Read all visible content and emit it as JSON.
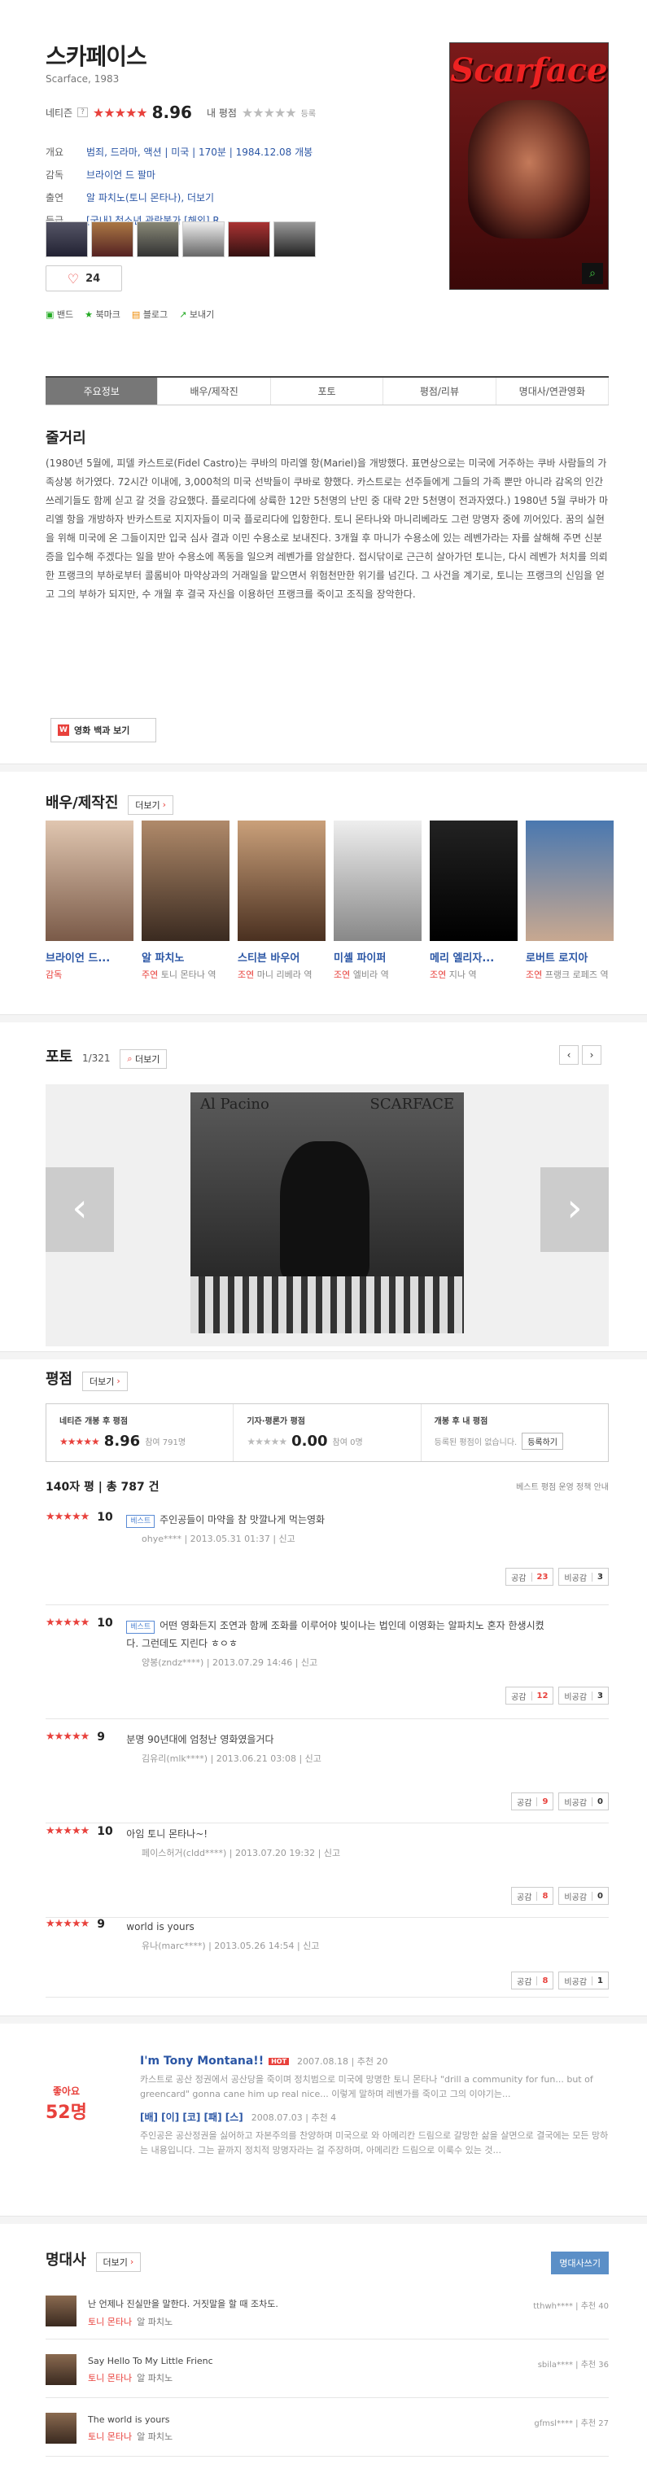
{
  "movie": {
    "title": "스카페이스",
    "subtitle": "Scarface, 1983",
    "netizen_label": "네티즌",
    "netizen_score": "8.96",
    "my_rating_label": "내 평점",
    "register_label": "등록",
    "info": [
      {
        "key": "개요",
        "value": "범죄, 드라마, 액션 | 미국 | 170분 | 1984.12.08 개봉"
      },
      {
        "key": "감독",
        "value": "브라이언 드 팔마"
      },
      {
        "key": "출연",
        "value": "알 파치노(토니 몬타나), 더보기"
      },
      {
        "key": "등급",
        "value": "[국내] 청소년 관람불가 [해외] R"
      }
    ],
    "like_count": "24",
    "share": [
      "밴드",
      "북마크",
      "블로그",
      "보내기"
    ],
    "poster_title": "Scarface"
  },
  "tabs": [
    "주요정보",
    "배우/제작진",
    "포토",
    "평점/리뷰",
    "명대사/연관영화"
  ],
  "synopsis": {
    "title": "줄거리",
    "text": "(1980년 5월에, 피델 카스트로(Fidel Castro)는 쿠바의 마리엘 항(Mariel)을 개방했다. 표면상으로는 미국에 거주하는 쿠바 사람들의 가족상봉 허가였다. 72시간 이내에, 3,000척의 미국 선박들이 쿠바로 향했다. 카스트로는 선주들에게 그들의 가족 뿐만 아니라 감옥의 인간 쓰레기들도 함께 싣고 갈 것을 강요했다. 플로리다에 상륙한 12만 5천명의 난민 중 대략 2만 5천명이 전과자였다.) 1980년 5월 쿠바가 마리엘 항을 개방하자 반카스트로 지지자들이 미국 플로리다에 입항한다. 토니 몬타나와 마니리베라도 그런 망명자 중에 끼어있다. 꿈의 실현을 위해 미국에 온 그들이지만 입국 심사 결과 이민 수용소로 보내진다. 3개월 후 마니가 수용소에 있는 레벤가라는 자를 살해해 주면 신분증을 입수해 주겠다는 일을 받아 수용소에 폭동을 일으켜 레벤가를 암살한다. 접시닦이로 근근히 살아가던 토니는, 다시 레벤가 처치를 의뢰한 프랭크의 부하로부터 콜롬비아 마약상과의 거래일을 맡으면서 위험천만한 위기를 넘긴다. 그 사건을 계기로, 토니는 프랭크의 신임을 얻고 그의 부하가 되지만, 수 개월 후 결국 자신을 이용하던 프랭크를 죽이고 조직을 장악한다.",
    "wiki_label": "영화 백과 보기"
  },
  "cast": {
    "title": "배우/제작진",
    "more": "더보기",
    "people": [
      {
        "name": "브라이언 드...",
        "role_type": "감독",
        "role": ""
      },
      {
        "name": "알 파치노",
        "role_type": "주연",
        "role": "토니 몬타나 역"
      },
      {
        "name": "스티븐 바우어",
        "role_type": "조연",
        "role": "마니 리베라 역"
      },
      {
        "name": "미셸 파이퍼",
        "role_type": "조연",
        "role": "엘비라 역"
      },
      {
        "name": "메리 엘리자...",
        "role_type": "조연",
        "role": "지나 역"
      },
      {
        "name": "로버트 로지아",
        "role_type": "조연",
        "role": "프랭크 로페즈 역"
      }
    ]
  },
  "photo": {
    "title": "포토",
    "counter": "1/321",
    "more": "더보기",
    "caption_left": "Al Pacino",
    "caption_right": "SCARFACE"
  },
  "rating": {
    "title": "평점",
    "more": "더보기",
    "netizen_label": "네티즌 개봉 후 평점",
    "netizen_score": "8.96",
    "netizen_count": "참여 791명",
    "critic_label": "기자·평론가 평점",
    "critic_score": "0.00",
    "critic_count": "참여 0명",
    "mine_label": "개봉 후 내 평점",
    "mine_text": "등록된 평점이 없습니다.",
    "mine_btn": "등록하기",
    "summary": "140자 평 | 총 787 건",
    "policy": "베스트 평점 운영 정책 안내"
  },
  "reviews": [
    {
      "score": "10",
      "best": "베스트",
      "text": "주인공들이 마약을 참 맛깔나게 먹는영화",
      "meta": "ohye**** | 2013.05.31 01:37 | 신고",
      "up": "23",
      "down": "3"
    },
    {
      "score": "10",
      "best": "베스트",
      "text": "어떤 영화든지 조연과 함께 조화를 이루어야 빛이나는 법인데 이영화는 알파치노 혼자 한생시켰다. 그런데도 지린다 ㅎㅇㅎ",
      "meta": "양봉(zndz****) | 2013.07.29 14:46 | 신고",
      "up": "12",
      "down": "3"
    },
    {
      "score": "9",
      "best": "",
      "text": "분명 90년대에 엄청난 영화였을거다",
      "meta": "김유리(mlk****) | 2013.06.21 03:08 | 신고",
      "up": "9",
      "down": "0"
    },
    {
      "score": "10",
      "best": "",
      "text": "아임 토니 몬타나~!",
      "meta": "페이스허거(cldd****) | 2013.07.20 19:32 | 신고",
      "up": "8",
      "down": "0"
    },
    {
      "score": "9",
      "best": "",
      "text": "world is yours",
      "meta": "유나(marc****) | 2013.05.26 14:54 | 신고",
      "up": "8",
      "down": "1"
    }
  ],
  "vote_up_label": "공감",
  "vote_down_label": "비공감",
  "news": {
    "likes_label": "좋아요",
    "likes_count": "52명",
    "headline": "I'm Tony Montana!!",
    "hot": "HOT",
    "headline_meta": "2007.08.18 | 추천 20",
    "desc": "카스트로 공산 정권에서 공산당을 죽이며 정치범으로 미국에 망명한 토니 몬타나 \"drill a community for fun... but of greencard\" gonna cane him up real nice... 이렇게 말하며 레벤가를 죽이고 그의 이야기는...",
    "headline2": "[배] [이] [코] [패] [스]",
    "headline2_meta": "2008.07.03 | 추천 4",
    "desc2": "주인공은 공산정권을 싫어하고 자본주의를 찬양하며 미국으로 와 아메리칸 드림으로 갈망한 삶을 살면으로 결국에는 모든 망하는 내용입니다. 그는 끝까지 정치적 망명자라는 걸 주장하며, 아메리칸 드림으로 이룩수 있는 것..."
  },
  "quotes": {
    "title": "명대사",
    "more": "더보기",
    "write": "명대사쓰기",
    "items": [
      {
        "text": "난 언제나 진실만을 말한다. 거짓말을 할 때 조차도.",
        "character": "토니 몬타나",
        "actor": "알 파치노",
        "meta": "tthwh**** | 추천 40"
      },
      {
        "text": "Say Hello To My Little Frienc",
        "character": "토니 몬타나",
        "actor": "알 파치노",
        "meta": "sbila**** | 추천 36"
      },
      {
        "text": "The world is yours",
        "character": "토니 몬타나",
        "actor": "알 파치노",
        "meta": "gfmsl**** | 추천 27"
      }
    ]
  }
}
